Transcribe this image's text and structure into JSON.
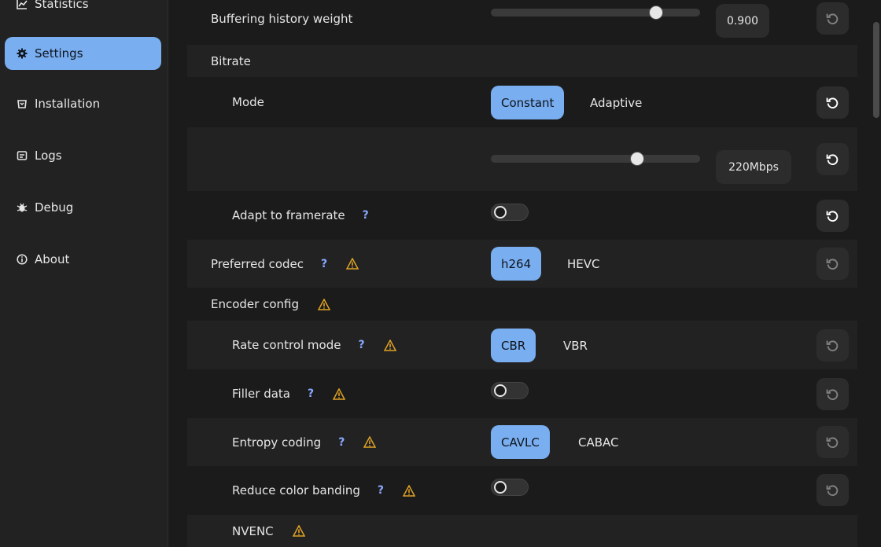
{
  "sidebar": {
    "items": [
      {
        "label": "Statistics",
        "icon": "chart-icon"
      },
      {
        "label": "Settings",
        "icon": "gear-icon",
        "active": true
      },
      {
        "label": "Installation",
        "icon": "install-icon"
      },
      {
        "label": "Logs",
        "icon": "logs-icon"
      },
      {
        "label": "Debug",
        "icon": "bug-icon"
      },
      {
        "label": "About",
        "icon": "info-icon"
      }
    ]
  },
  "settings": {
    "buffering": {
      "label": "Buffering history weight",
      "value": "0.900",
      "slider_fraction": 0.79
    },
    "bitrate": {
      "label": "Bitrate"
    },
    "mode": {
      "label": "Mode",
      "options": [
        "Constant",
        "Adaptive"
      ],
      "selected": "Constant"
    },
    "bitrate_value": {
      "value": "220Mbps",
      "slider_fraction": 0.7
    },
    "adapt_framerate": {
      "label": "Adapt to framerate",
      "help": "?",
      "enabled": false
    },
    "preferred_codec": {
      "label": "Preferred codec",
      "help": "?",
      "options": [
        "h264",
        "HEVC"
      ],
      "selected": "h264"
    },
    "encoder_config": {
      "label": "Encoder config"
    },
    "rate_control": {
      "label": "Rate control mode",
      "help": "?",
      "options": [
        "CBR",
        "VBR"
      ],
      "selected": "CBR"
    },
    "filler_data": {
      "label": "Filler data",
      "help": "?",
      "enabled": false
    },
    "entropy_coding": {
      "label": "Entropy coding",
      "help": "?",
      "options": [
        "CAVLC",
        "CABAC"
      ],
      "selected": "CAVLC"
    },
    "color_banding": {
      "label": "Reduce color banding",
      "help": "?",
      "enabled": false
    },
    "nvenc": {
      "label": "NVENC"
    }
  },
  "colors": {
    "accent": "#79aef0",
    "warning": "#e0a224",
    "help": "#8aa8ff"
  }
}
